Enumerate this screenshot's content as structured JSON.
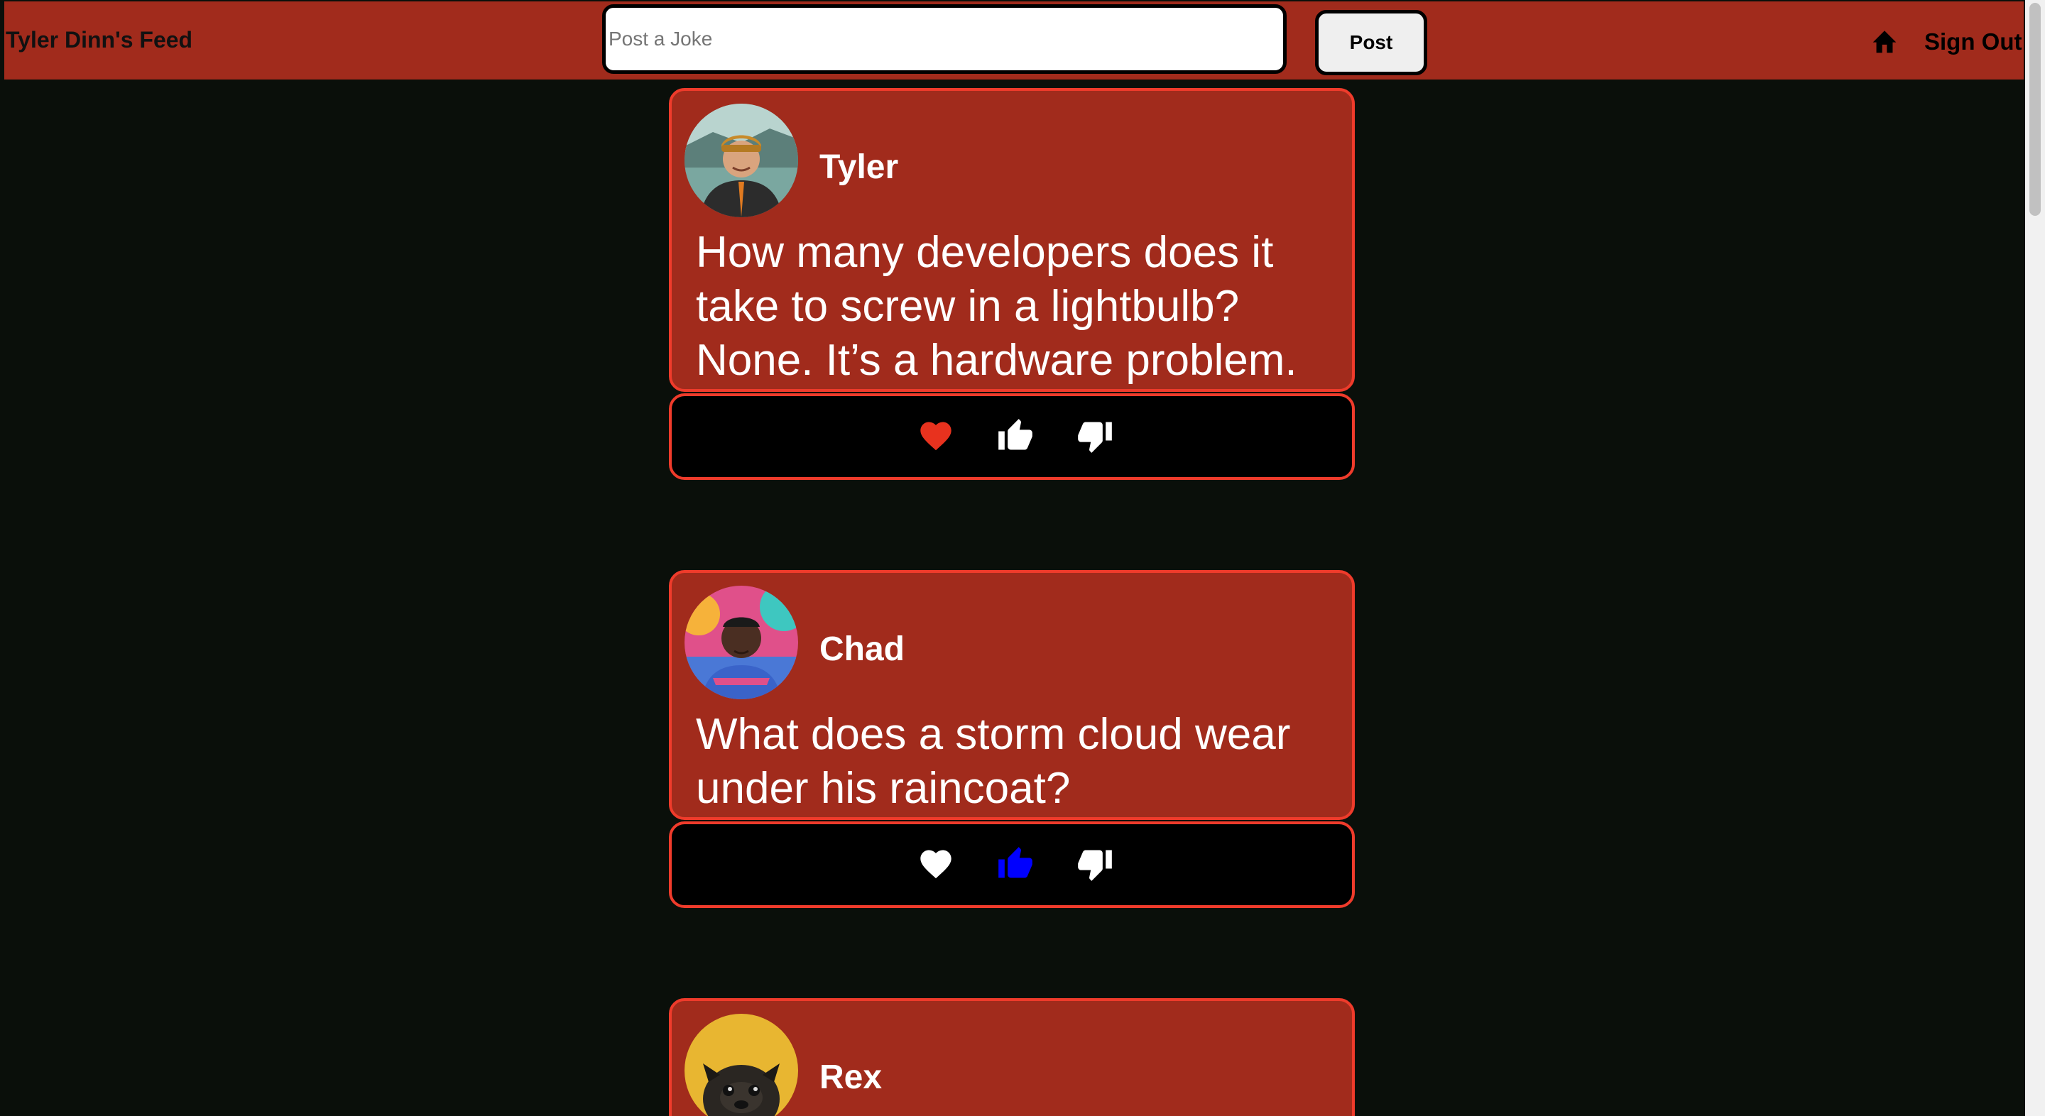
{
  "header": {
    "title": "Tyler Dinn's Feed",
    "post_placeholder": "Post a Joke",
    "post_input_value": "",
    "post_button": "Post",
    "home_icon": "home-icon",
    "sign_out": "Sign Out"
  },
  "feed": {
    "posts": [
      {
        "username": "Tyler",
        "joke": "How many developers does it take to screw in a lightbulb? None. It’s a hardware problem.",
        "liked": true,
        "thumbs_up": false,
        "thumbs_down": false
      },
      {
        "username": "Chad",
        "joke": "What does a storm cloud wear under his raincoat? Thunderwear.",
        "liked": false,
        "thumbs_up": true,
        "thumbs_down": false
      },
      {
        "username": "Rex",
        "joke": ""
      }
    ]
  },
  "colors": {
    "header_bg": "#a12b1c",
    "card_bg": "#a12b1c",
    "card_border": "#ef3b2b",
    "page_bg": "#0a0f0a",
    "heart_active": "#e8321e",
    "thumb_active": "#0000ff",
    "icon_default": "#ffffff"
  }
}
